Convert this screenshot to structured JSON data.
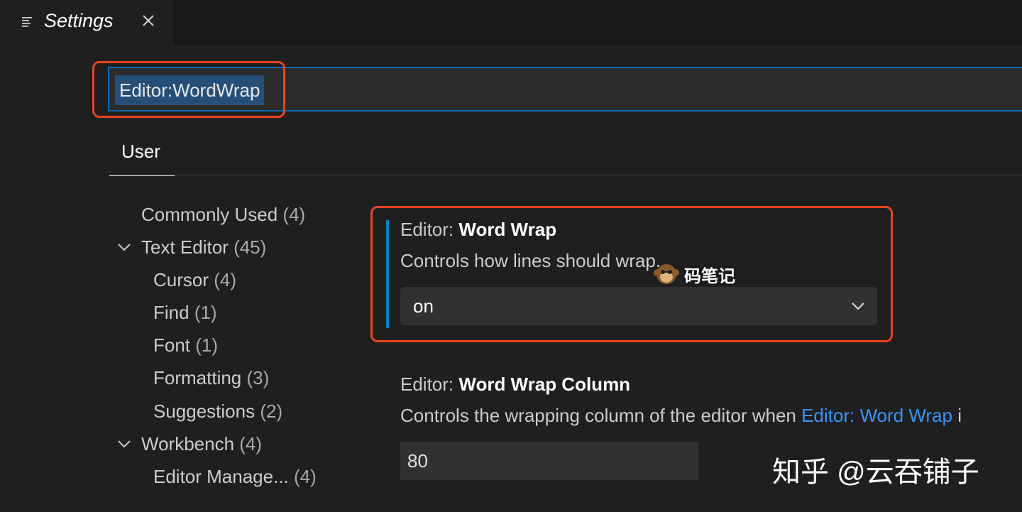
{
  "tab": {
    "icon": "settings-list-icon",
    "title": "Settings",
    "close_icon": "close-icon"
  },
  "search": {
    "value": "Editor:WordWrap"
  },
  "scope_tabs": [
    {
      "label": "User"
    }
  ],
  "toc": {
    "commonly_used": {
      "label": "Commonly Used",
      "count": "(4)"
    },
    "text_editor": {
      "label": "Text Editor",
      "count": "(45)"
    },
    "cursor": {
      "label": "Cursor",
      "count": "(4)"
    },
    "find": {
      "label": "Find",
      "count": "(1)"
    },
    "font": {
      "label": "Font",
      "count": "(1)"
    },
    "formatting": {
      "label": "Formatting",
      "count": "(3)"
    },
    "suggestions": {
      "label": "Suggestions",
      "count": "(2)"
    },
    "workbench": {
      "label": "Workbench",
      "count": "(4)"
    },
    "editor_management": {
      "label": "Editor Manage...",
      "count": "(4)"
    }
  },
  "settings": {
    "word_wrap": {
      "category": "Editor: ",
      "key": "Word Wrap",
      "description": "Controls how lines should wrap.",
      "value": "on"
    },
    "word_wrap_column": {
      "category": "Editor: ",
      "key": "Word Wrap Column",
      "description_prefix": "Controls the wrapping column of the editor when ",
      "description_link": "Editor: Word Wrap",
      "description_suffix": " i",
      "value": "80"
    }
  },
  "watermarks": {
    "center_text": "码笔记",
    "corner_text": "知乎 @云吞铺子"
  },
  "colors": {
    "highlight_border": "#e8441f",
    "focus_bar": "#0c7ec1",
    "link": "#3794ff",
    "selection": "#264f78"
  }
}
